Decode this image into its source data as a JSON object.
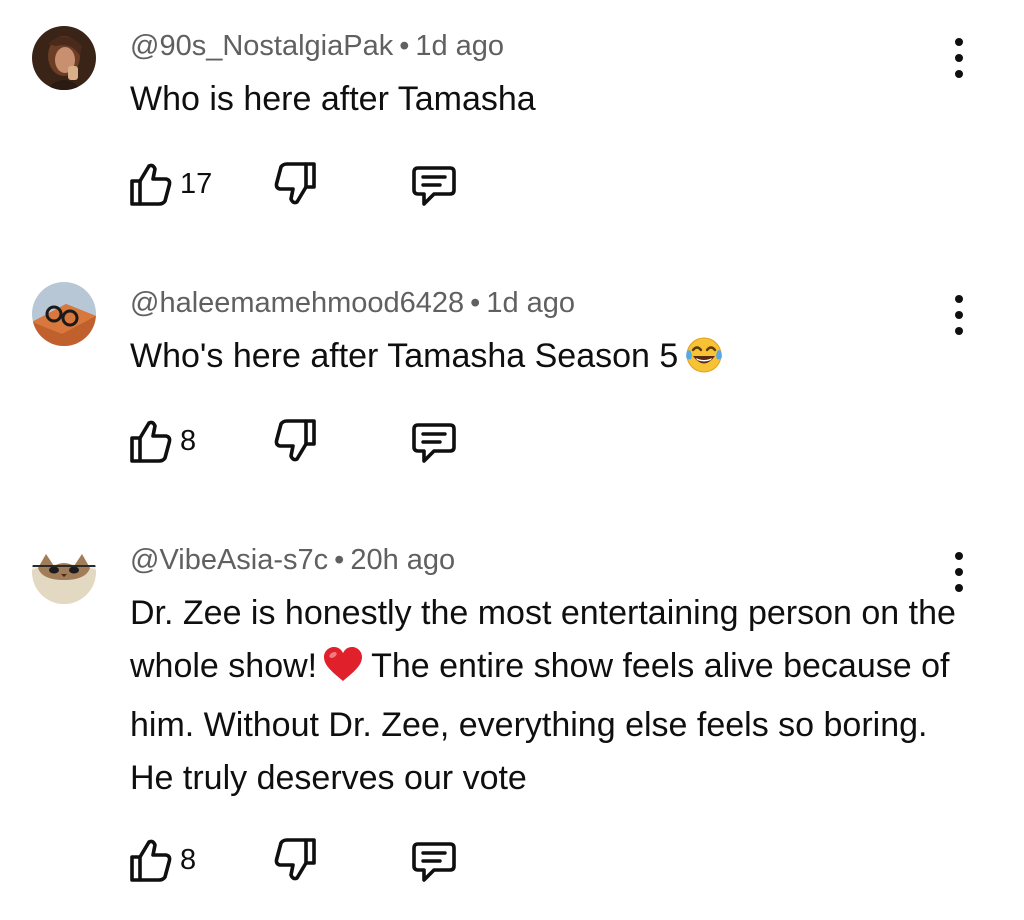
{
  "comments": [
    {
      "author": "@90s_NostalgiaPak",
      "separator": "•",
      "time": "1d ago",
      "text": "Who is here after Tamasha",
      "likes": "17"
    },
    {
      "author": "@haleemamehmood6428",
      "separator": "•",
      "time": "1d ago",
      "text": "Who's here after Tamasha Season 5",
      "emoji": "face-with-tears-of-joy",
      "likes": "8"
    },
    {
      "author": "@VibeAsia-s7c",
      "separator": "•",
      "time": "20h ago",
      "text_part1": "Dr. Zee is honestly the most entertaining person on the whole show!",
      "emoji": "red-heart",
      "text_part2": "The entire show feels alive because of him. Without Dr. Zee, everything else feels so boring. He truly deserves our vote",
      "likes": "8"
    }
  ],
  "icons": {
    "like": "thumbs-up-icon",
    "dislike": "thumbs-down-icon",
    "reply": "reply-icon",
    "more": "more-vert-icon"
  },
  "colors": {
    "text": "#0f0f0f",
    "meta": "#606060",
    "heart": "#e0202a",
    "emoji_face": "#f7c234"
  }
}
